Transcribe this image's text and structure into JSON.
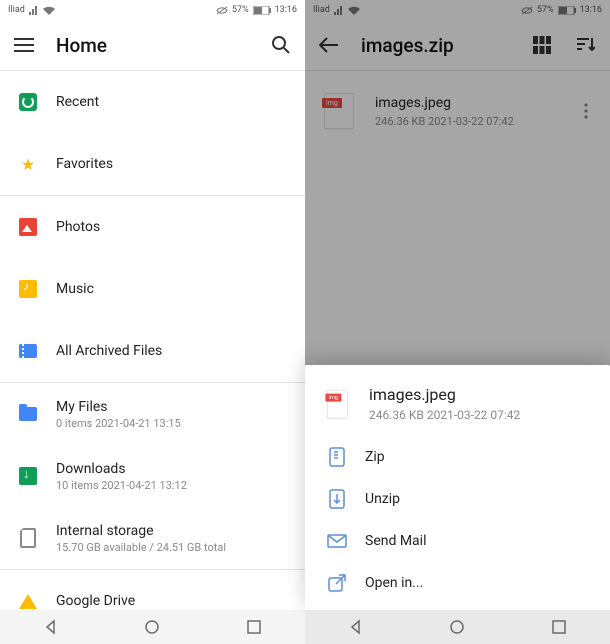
{
  "status": {
    "carrier": "Iliad",
    "battery_pct": "57%",
    "time": "13:16"
  },
  "left": {
    "title": "Home",
    "items": [
      {
        "label": "Recent"
      },
      {
        "label": "Favorites"
      },
      {
        "label": "Photos"
      },
      {
        "label": "Music"
      },
      {
        "label": "All Archived Files"
      },
      {
        "label": "My Files",
        "sub": "0 items 2021-04-21 13:15"
      },
      {
        "label": "Downloads",
        "sub": "10 items 2021-04-21 13:12"
      },
      {
        "label": "Internal storage",
        "sub": "15.70 GB available / 24.51 GB total"
      },
      {
        "label": "Google Drive"
      }
    ]
  },
  "right": {
    "title": "images.zip",
    "file": {
      "name": "images.jpeg",
      "sub": "246.36 KB  2021-03-22 07:42"
    },
    "sheet": {
      "name": "images.jpeg",
      "sub": "246.36 KB  2021-03-22 07:42",
      "actions": [
        {
          "label": "Zip"
        },
        {
          "label": "Unzip"
        },
        {
          "label": "Send Mail"
        },
        {
          "label": "Open in..."
        }
      ]
    }
  }
}
